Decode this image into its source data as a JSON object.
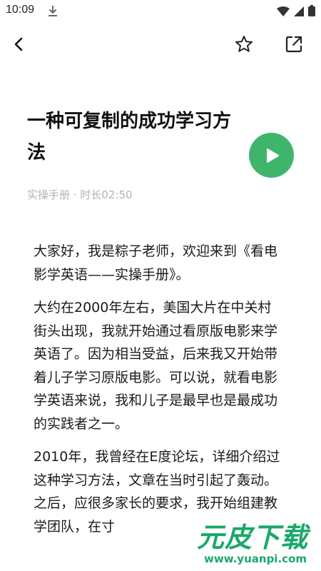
{
  "status_bar": {
    "time": "10:09"
  },
  "nav": {},
  "article": {
    "title": "一种可复制的成功学习方法",
    "meta": "实操手册 · 时长02:50",
    "paragraphs": [
      "大家好，我是粽子老师，欢迎来到《看电影学英语——实操手册》。",
      "大约在2000年左右，美国大片在中关村街头出现，我就开始通过看原版电影来学英语了。因为相当受益，后来我又开始带着儿子学习原版电影。可以说，就看电影学英语来说，我和儿子是最早也是最成功的实践者之一。",
      "2010年，我曾经在E度论坛，详细介绍过这种学习方法，文章在当时引起了轰动。之后，应很多家长的要求，我开始组建教学团队，在寸"
    ]
  },
  "watermark": {
    "logo": "元皮下载",
    "url": "www.yuanpi.com"
  },
  "colors": {
    "accent": "#3fb56c",
    "meta_text": "#b3b3b3"
  }
}
